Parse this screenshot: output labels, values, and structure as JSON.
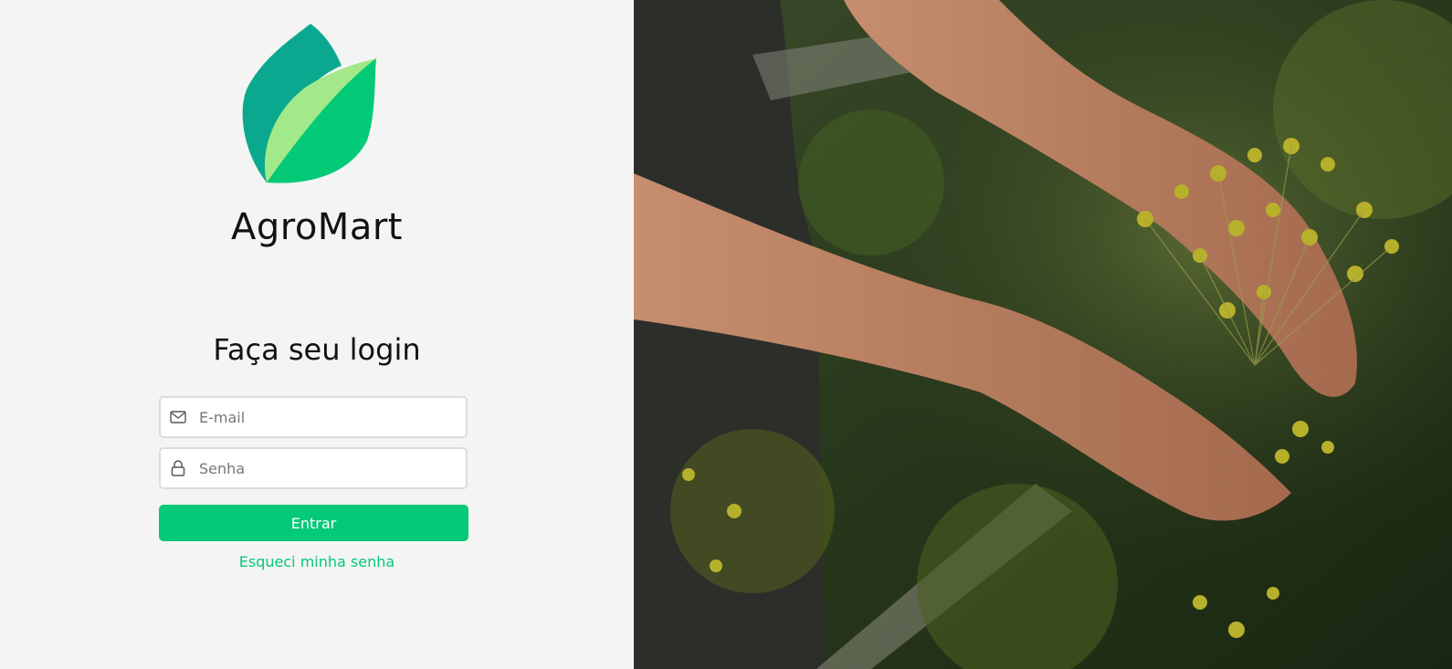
{
  "brand": {
    "name": "AgroMart",
    "logo_icon": "leaves-logo-icon",
    "colors": {
      "leaf_back": "#0aa98f",
      "leaf_front_light": "#a2e98a",
      "leaf_front_dark": "#04c977"
    }
  },
  "login": {
    "title": "Faça seu login",
    "email": {
      "placeholder": "E-mail",
      "value": "",
      "icon": "mail-icon"
    },
    "password": {
      "placeholder": "Senha",
      "value": "",
      "icon": "lock-icon"
    },
    "submit_label": "Entrar",
    "forgot_label": "Esqueci minha senha"
  },
  "theme": {
    "accent": "#04c977",
    "background": "#f4f4f4"
  },
  "hero": {
    "image": "hands-holding-dill-flowers-photo"
  }
}
